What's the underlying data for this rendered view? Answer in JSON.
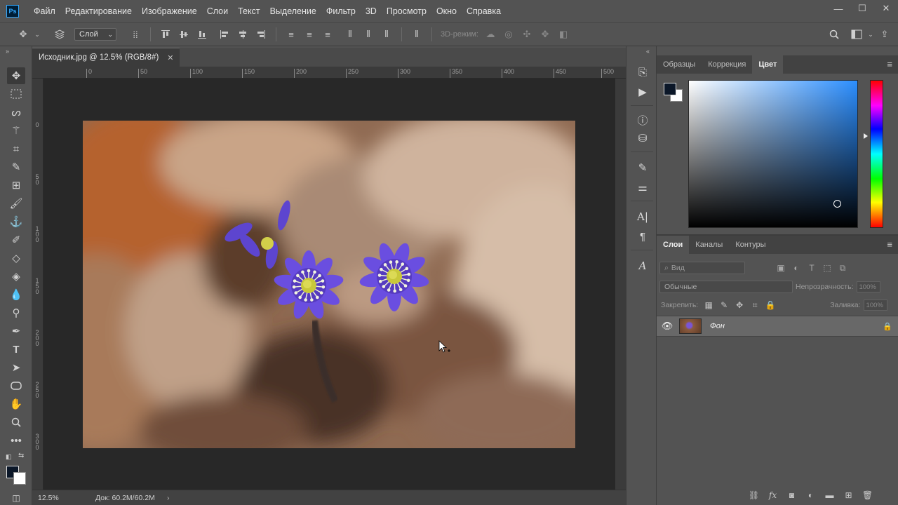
{
  "app": {
    "logo": "Ps"
  },
  "menu": [
    "Файл",
    "Редактирование",
    "Изображение",
    "Слои",
    "Текст",
    "Выделение",
    "Фильтр",
    "3D",
    "Просмотр",
    "Окно",
    "Справка"
  ],
  "window_controls": {
    "minimize": "—",
    "maximize": "☐",
    "close": "✕"
  },
  "options": {
    "layer_select": "Слой",
    "three_d_label": "3D-режим:"
  },
  "document": {
    "tab_title": "Исходник.jpg @ 12.5% (RGB/8#)",
    "tab_close": "✕",
    "ruler_h": [
      "0",
      "50",
      "100",
      "150",
      "200",
      "250",
      "300",
      "350",
      "400",
      "450",
      "500"
    ],
    "ruler_v": [
      "0",
      "5 0",
      "1 0 0",
      "1 5 0",
      "2 0 0",
      "2 5 0",
      "3 0 0"
    ]
  },
  "status": {
    "zoom": "12.5%",
    "doc_size": "Док: 60.2M/60.2M",
    "arrow": "›"
  },
  "color_panel": {
    "tabs": [
      "Образцы",
      "Коррекция",
      "Цвет"
    ],
    "active_tab": "Цвет",
    "foreground": "#0b1728",
    "background": "#ffffff",
    "hue_color": "#2b8eff"
  },
  "layers_panel": {
    "tabs": [
      "Слои",
      "Каналы",
      "Контуры"
    ],
    "active_tab": "Слои",
    "kind_filter": "Вид",
    "blend_mode": "Обычные",
    "opacity_label": "Непрозрачность:",
    "opacity_value": "100%",
    "lock_label": "Закрепить:",
    "fill_label": "Заливка:",
    "fill_value": "100%",
    "layer_name": "Фон"
  },
  "panel_menu_icon": "≡",
  "colors": {
    "ui_bg": "#535353",
    "dark_bg": "#282828",
    "accent_blue": "#31a8ff"
  }
}
